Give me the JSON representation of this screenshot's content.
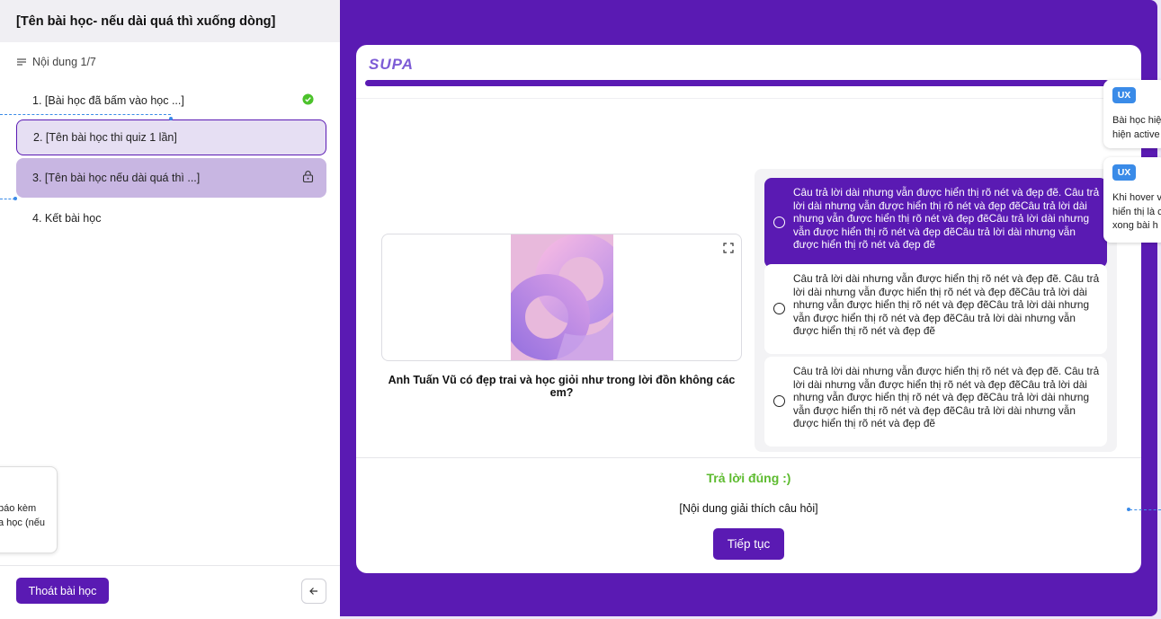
{
  "sidebar": {
    "lesson_title": "[Tên bài học- nếu dài quá thì xuống dòng]",
    "toc_label": "Nội dung 1/7",
    "items": [
      {
        "label": "1. [Bài học đã bấm vào học ...]",
        "status": "completed"
      },
      {
        "label": "2. [Tên bài học thi quiz 1 lần]",
        "status": "active"
      },
      {
        "label": "3. [Tên bài học nếu dài quá thì ...]",
        "status": "locked"
      },
      {
        "label": "4. Kết bài học",
        "status": "normal"
      }
    ],
    "exit_label": "Thoát bài học",
    "note": {
      "line1": "báo kèm",
      "line2": "a học (nếu"
    }
  },
  "quiz": {
    "logo": "SUPA",
    "progress_fraction": 0.97,
    "question": "Anh Tuấn Vũ có đẹp trai và học giỏi như trong lời đồn không các em?",
    "answers": [
      {
        "text": "Câu trả lời dài nhưng vẫn được hiển thị rõ nét và đẹp đẽ. Câu trả lời dài nhưng vẫn được hiển thị rõ nét và đẹp đẽCâu trả lời dài nhưng vẫn được hiển thị rõ nét và đẹp đẽCâu trả lời dài nhưng vẫn được hiển thị rõ nét và đẹp đẽCâu trả lời dài nhưng vẫn được hiển thị rõ nét và đẹp đẽ",
        "selected": true
      },
      {
        "text": "Câu trả lời dài nhưng vẫn được hiển thị rõ nét và đẹp đẽ. Câu trả lời dài nhưng vẫn được hiển thị rõ nét và đẹp đẽCâu trả lời dài nhưng vẫn được hiển thị rõ nét và đẹp đẽCâu trả lời dài nhưng vẫn được hiển thị rõ nét và đẹp đẽCâu trả lời dài nhưng vẫn được hiển thị rõ nét và đẹp đẽ",
        "selected": false
      },
      {
        "text": "Câu trả lời dài nhưng vẫn được hiển thị rõ nét và đẹp đẽ. Câu trả lời dài nhưng vẫn được hiển thị rõ nét và đẹp đẽCâu trả lời dài nhưng vẫn được hiển thị rõ nét và đẹp đẽCâu trả lời dài nhưng vẫn được hiển thị rõ nét và đẹp đẽCâu trả lời dài nhưng vẫn được hiển thị rõ nét và đẹp đẽ",
        "selected": false
      }
    ],
    "feedback": "Trả lời đúng :)",
    "explanation": "[Nội dung giải thích câu hỏi]",
    "next_label": "Tiếp tục"
  },
  "ux_notes": [
    {
      "badge": "UX",
      "line1": "Bài học hiệ",
      "line2": "hiện active"
    },
    {
      "badge": "UX",
      "line1": "Khi hover v",
      "line2": "hiển thị là c",
      "line3": "xong bài h"
    }
  ],
  "colors": {
    "brand": "#5a1ab3",
    "active_bg": "#e6dff3",
    "locked_bg": "#c8b6e2",
    "success": "#5dbb2f",
    "annotation": "#3a8be8"
  },
  "icons": [
    "list-icon",
    "check-circle-icon",
    "lock-icon",
    "arrow-left-icon",
    "expand-icon"
  ]
}
